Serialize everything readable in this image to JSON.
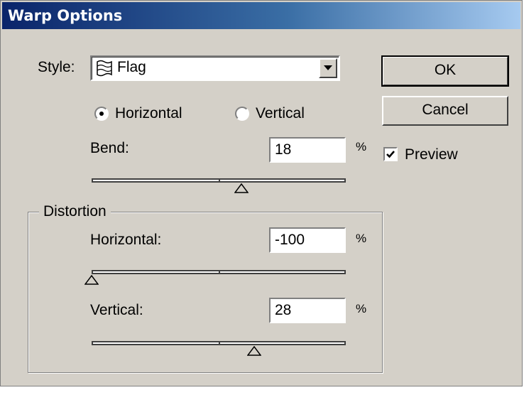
{
  "window": {
    "title": "Warp Options"
  },
  "style_select": {
    "label": "Style:",
    "value": "Flag",
    "icon": "flag-icon"
  },
  "buttons": {
    "ok": "OK",
    "cancel": "Cancel"
  },
  "preview": {
    "label": "Preview",
    "checked": true
  },
  "orientation": {
    "horizontal_label": "Horizontal",
    "vertical_label": "Vertical",
    "selected": "Horizontal"
  },
  "bend": {
    "label": "Bend:",
    "value": "18",
    "unit": "%",
    "percent": 18
  },
  "distortion": {
    "group_label": "Distortion",
    "horizontal": {
      "label": "Horizontal:",
      "value": "-100",
      "unit": "%",
      "percent": -100
    },
    "vertical": {
      "label": "Vertical:",
      "value": "28",
      "unit": "%",
      "percent": 28
    }
  }
}
